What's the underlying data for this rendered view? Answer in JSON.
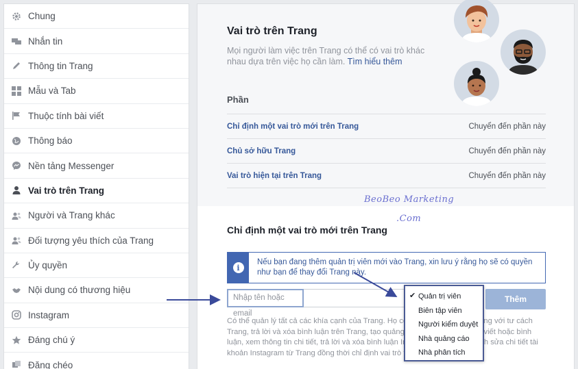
{
  "sidebar": {
    "items": [
      {
        "label": "Chung",
        "icon": "gear-icon",
        "active": false
      },
      {
        "label": "Nhắn tin",
        "icon": "chat-bubbles-icon",
        "active": false
      },
      {
        "label": "Thông tin Trang",
        "icon": "pencil-icon",
        "active": false
      },
      {
        "label": "Mẫu và Tab",
        "icon": "grid-icon",
        "active": false
      },
      {
        "label": "Thuộc tính bài viết",
        "icon": "flag-icon",
        "active": false
      },
      {
        "label": "Thông báo",
        "icon": "globe-icon",
        "active": false
      },
      {
        "label": "Nền tảng Messenger",
        "icon": "messenger-icon",
        "active": false
      },
      {
        "label": "Vai trò trên Trang",
        "icon": "person-icon",
        "active": true
      },
      {
        "label": "Người và Trang khác",
        "icon": "people-icon",
        "active": false
      },
      {
        "label": "Đối tượng yêu thích của Trang",
        "icon": "people-icon",
        "active": false
      },
      {
        "label": "Ủy quyền",
        "icon": "wrench-icon",
        "active": false
      },
      {
        "label": "Nội dung có thương hiệu",
        "icon": "handshake-icon",
        "active": false
      },
      {
        "label": "Instagram",
        "icon": "instagram-icon",
        "active": false
      },
      {
        "label": "Đáng chú ý",
        "icon": "star-icon",
        "active": false
      },
      {
        "label": "Đăng chéo",
        "icon": "crosspost-icon",
        "active": false
      }
    ]
  },
  "header": {
    "title": "Vai trò trên Trang",
    "description": "Mọi người làm việc trên Trang có thể có vai trò khác nhau dựa trên việc họ cần làm.",
    "learn_more": "Tìm hiểu thêm"
  },
  "sections": {
    "heading": "Phần",
    "goto_label": "Chuyển đến phần này",
    "items": [
      {
        "label": "Chỉ định một vai trò mới trên Trang"
      },
      {
        "label": "Chủ sở hữu Trang"
      },
      {
        "label": "Vai trò hiện tại trên Trang"
      }
    ]
  },
  "watermark": {
    "line1": "BeoBeo Marketing",
    "line2": ".Com"
  },
  "assign": {
    "title": "Chỉ định một vai trò mới trên Trang",
    "info": "Nếu bạn đang thêm quản trị viên mới vào Trang, xin lưu ý rằng họ sẽ có quyền như bạn để thay đổi Trang này.",
    "input_placeholder": "Nhập tên hoặc email",
    "add_button": "Thêm",
    "body_text": "Có thể quản lý tất cả các khía cạnh của Trang. Họ có thể gửi tin nhắn và đăng với tư cách Trang, trả lời và xóa bình luận trên Trang, tạo quảng cáo, xem ai đã tạo bài viết hoặc bình luận, xem thông tin chi tiết, trả lời và xóa bình luận Instagram từ Trang, chỉnh sửa chi tiết tài khoản Instagram từ Trang đồng thời chỉ định vai trò trên Trang."
  },
  "role_dropdown": {
    "selected": "Quản trị viên",
    "options": [
      "Quản trị viên",
      "Biên tập viên",
      "Người kiểm duyệt",
      "Nhà quảng cáo",
      "Nhà phân tích"
    ]
  },
  "colors": {
    "link": "#365899",
    "accent": "#4267b2",
    "button": "#9cb4d8",
    "annotation_arrow": "#3a4a9a"
  }
}
